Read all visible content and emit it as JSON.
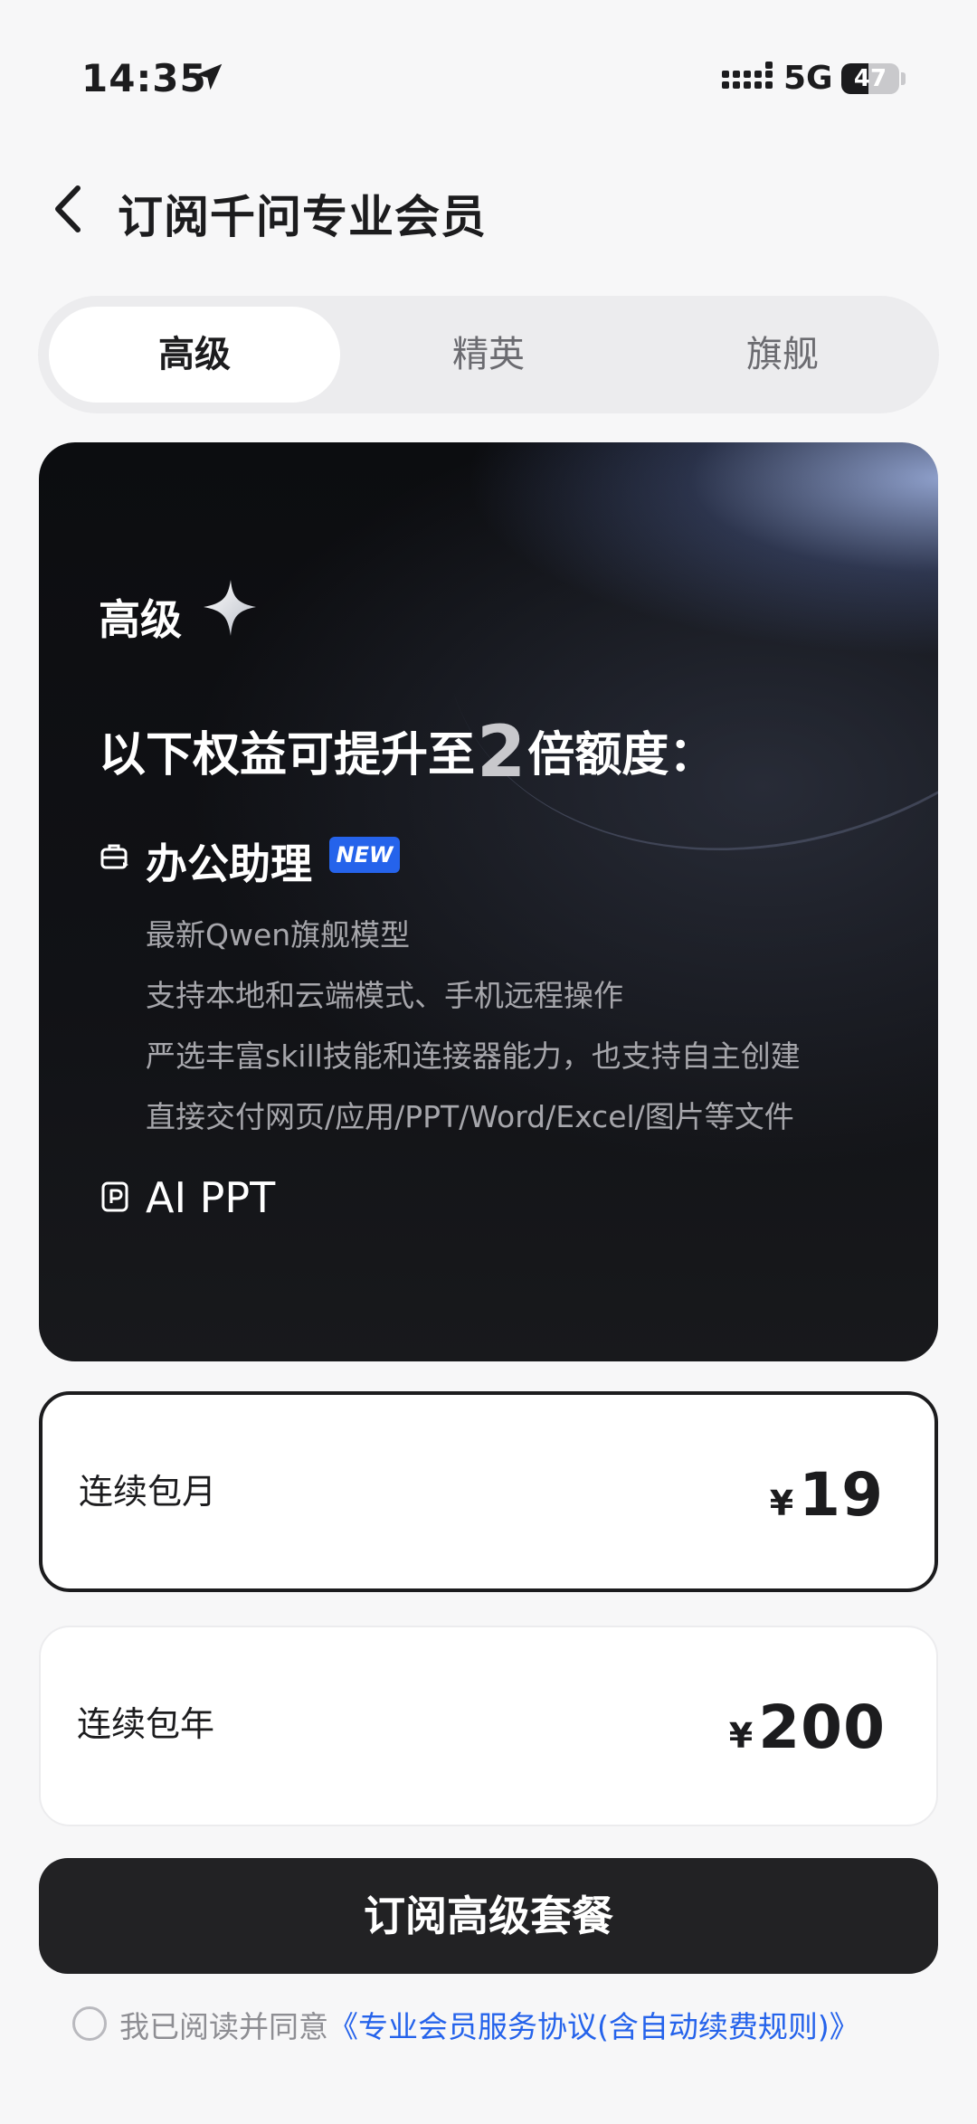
{
  "status_bar": {
    "time": "14:35",
    "network": "5G",
    "battery_level": "47",
    "battery_fraction": 0.47
  },
  "header": {
    "title": "订阅千问专业会员"
  },
  "tabs": [
    {
      "label": "高级",
      "active": true
    },
    {
      "label": "精英",
      "active": false
    },
    {
      "label": "旗舰",
      "active": false
    }
  ],
  "hero": {
    "tier": "高级",
    "headline_prefix": "以下权益可提升至",
    "multiplier": "2",
    "headline_suffix": "倍额度：",
    "features": [
      {
        "title": "办公助理",
        "badge": "NEW",
        "items": [
          "最新Qwen旗舰模型",
          "支持本地和云端模式、手机远程操作",
          "严选丰富skill技能和连接器能力，也支持自主创建",
          "直接交付网页/应用/PPT/Word/Excel/图片等文件"
        ]
      },
      {
        "title": "AI PPT"
      }
    ]
  },
  "plans": [
    {
      "label": "连续包月",
      "currency": "¥",
      "amount": "19",
      "selected": true
    },
    {
      "label": "连续包年",
      "currency": "¥",
      "amount": "200",
      "selected": false
    }
  ],
  "cta": {
    "label": "订阅高级套餐"
  },
  "agreement": {
    "text": "我已阅读并同意",
    "link": "《专业会员服务协议(含自动续费规则)》",
    "checked": false
  },
  "colors": {
    "accent_blue": "#2563eb",
    "button_dark": "#222224",
    "page_bg": "#f7f7f8"
  }
}
